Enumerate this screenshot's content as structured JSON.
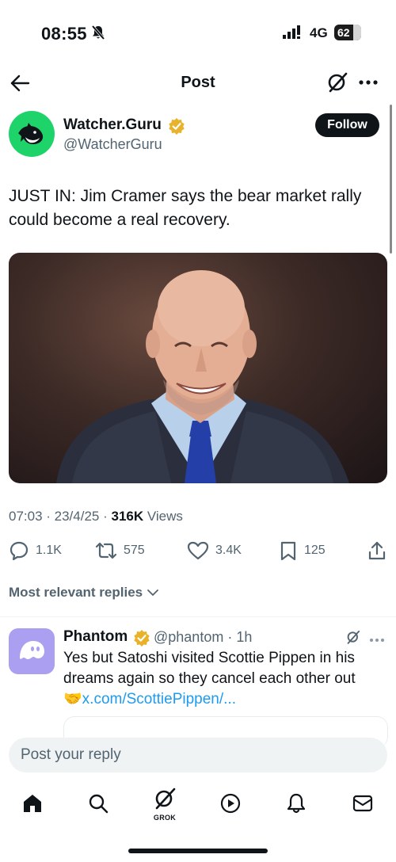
{
  "status_bar": {
    "time": "08:55",
    "network": "4G",
    "battery": "62",
    "icons": [
      "bell-muted-icon",
      "signal-icon",
      "battery-icon"
    ]
  },
  "header": {
    "title": "Post",
    "icons": [
      "back-arrow-icon",
      "grok-icon",
      "more-icon"
    ]
  },
  "post": {
    "author_name": "Watcher.Guru",
    "author_handle": "@WatcherGuru",
    "follow_label": "Follow",
    "text": "JUST IN: Jim Cramer says the bear market rally could become a real recovery.",
    "time_date": "07:03 · 23/4/25 · ",
    "views_count": "316K",
    "views_label": " Views",
    "stats": {
      "replies": "1.1K",
      "reposts": "575",
      "likes": "3.4K",
      "bookmarks": "125"
    }
  },
  "replies_section": {
    "sort_label": "Most relevant replies"
  },
  "reply": {
    "name": "Phantom",
    "handle_time": "@phantom · 1h",
    "text": "Yes but Satoshi visited Scottie Pippen in his dreams again so they cancel each other out",
    "emoji": "🤝",
    "link": "x.com/ScottiePippen/..."
  },
  "composer": {
    "placeholder": "Post your reply"
  },
  "tabbar": {
    "grok_label": "GROK",
    "icons": [
      "home-icon",
      "search-icon",
      "grok-icon",
      "video-icon",
      "notifications-icon",
      "messages-icon"
    ]
  },
  "colors": {
    "accent": "#1d9bf0",
    "text": "#0f1419",
    "secondary": "#536471",
    "avatar_green": "#1fd36b",
    "phantom_purple": "#ab9ff2",
    "verified_gold": "#e8b32a"
  }
}
